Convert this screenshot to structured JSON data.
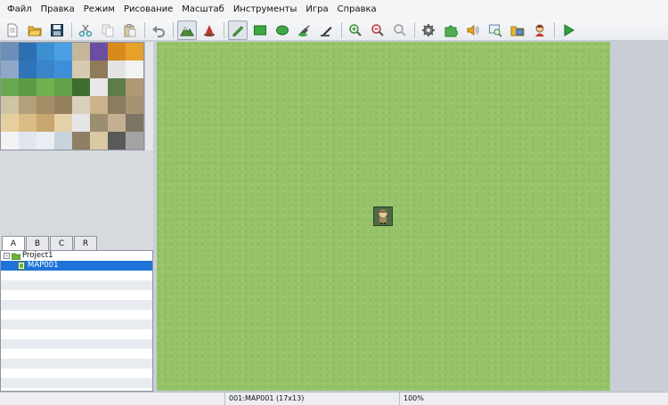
{
  "menu": {
    "items": [
      "Файл",
      "Правка",
      "Режим",
      "Рисование",
      "Масштаб",
      "Инструменты",
      "Игра",
      "Справка"
    ]
  },
  "toolbar": {
    "buttons": [
      "new-project",
      "open-project",
      "save-project",
      "cut",
      "copy",
      "paste",
      "undo",
      "map-mode",
      "event-mode",
      "pencil",
      "rectangle",
      "ellipse",
      "flood-fill",
      "shadow-pen",
      "zoom-in",
      "zoom-out",
      "zoom-reset",
      "database",
      "plugin-manager",
      "sound-test",
      "event-searcher",
      "resource-manager",
      "character-generator",
      "playtest"
    ]
  },
  "tileset_tabs": [
    "A",
    "B",
    "C",
    "R"
  ],
  "map_tree": {
    "project": "Project1",
    "map": "MAP001"
  },
  "status": {
    "map_info": "001:MAP001 (17x13)",
    "zoom": "100%"
  },
  "colors": {
    "accent": "#1f73d9",
    "grass": "#97c46b"
  }
}
